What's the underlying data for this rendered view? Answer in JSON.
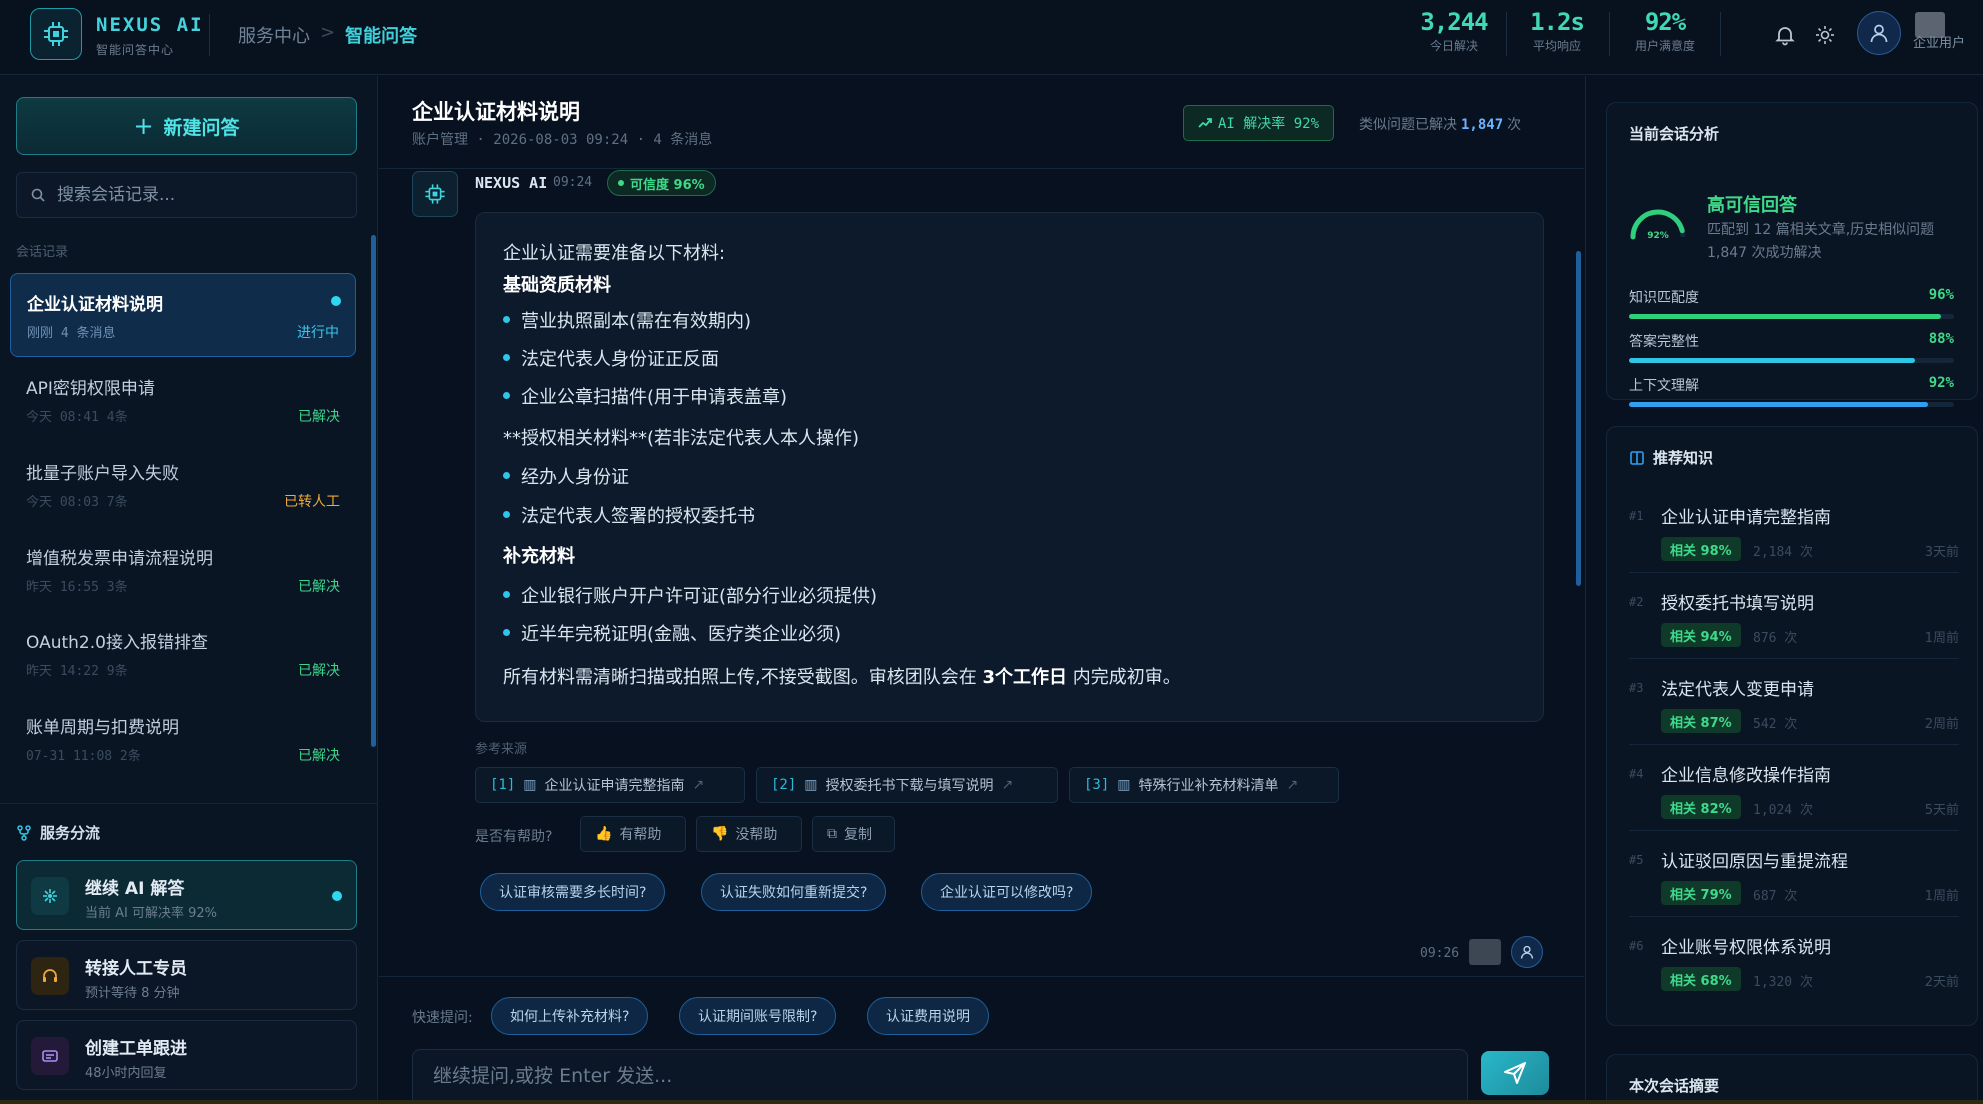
{
  "brand": {
    "name": "NEXUS AI",
    "subtitle": "智能问答中心"
  },
  "breadcrumb": {
    "parent": "服务中心",
    "separator": ">",
    "current": "智能问答"
  },
  "header_stats": [
    {
      "value": "3,244",
      "label": "今日解决"
    },
    {
      "value": "1.2s",
      "label": "平均响应"
    },
    {
      "value": "92%",
      "label": "用户满意度"
    }
  ],
  "user": {
    "label": "企业用户"
  },
  "sidebar": {
    "new_button": "新建问答",
    "search_placeholder": "搜索会话记录...",
    "section_label": "会话记录",
    "conversations": [
      {
        "title": "企业认证材料说明",
        "meta": "刚刚 4 条消息",
        "status": "进行中",
        "status_type": "ongoing",
        "active": true
      },
      {
        "title": "API密钥权限申请",
        "meta": "今天 08:41 4条",
        "status": "已解决",
        "status_type": "resolved"
      },
      {
        "title": "批量子账户导入失败",
        "meta": "今天 08:03 7条",
        "status": "已转人工",
        "status_type": "human"
      },
      {
        "title": "增值税发票申请流程说明",
        "meta": "昨天 16:55 3条",
        "status": "已解决",
        "status_type": "resolved"
      },
      {
        "title": "OAuth2.0接入报错排查",
        "meta": "昨天 14:22 9条",
        "status": "已解决",
        "status_type": "resolved"
      },
      {
        "title": "账单周期与扣费说明",
        "meta": "07-31 11:08 2条",
        "status": "已解决",
        "status_type": "resolved"
      }
    ],
    "routing": {
      "title": "服务分流",
      "items": [
        {
          "title": "继续 AI 解答",
          "sub": "当前 AI 可解决率 92%",
          "active": true
        },
        {
          "title": "转接人工专员",
          "sub": "预计等待 8 分钟"
        },
        {
          "title": "创建工单跟进",
          "sub": "48小时内回复"
        }
      ]
    }
  },
  "chat": {
    "title": "企业认证材料说明",
    "subtitle": "账户管理 · 2026-08-03 09:24 · 4 条消息",
    "ai_rate": "AI 解决率 92%",
    "similar_prefix": "类似问题已解决",
    "similar_count": "1,847",
    "similar_suffix": "次",
    "bot_name": "NEXUS AI",
    "bot_time": "09:24",
    "confidence": "可信度 96%",
    "message": {
      "intro": "企业认证需要准备以下材料:",
      "h1": "基础资质材料",
      "b1": "营业执照副本(需在有效期内)",
      "b2": "法定代表人身份证正反面",
      "b3": "企业公章扫描件(用于申请表盖章)",
      "p2": "**授权相关材料**(若非法定代表人本人操作)",
      "b4": "经办人身份证",
      "b5": "法定代表人签署的授权委托书",
      "h2": "补充材料",
      "b6": "企业银行账户开户许可证(部分行业必须提供)",
      "b7": "近半年完税证明(金融、医疗类企业必须)",
      "closing_pre": "所有材料需清晰扫描或拍照上传,不接受截图。审核团队会在",
      "closing_bold": "3个工作日",
      "closing_post": "内完成初审。"
    },
    "refs_label": "参考来源",
    "refs": [
      {
        "n": "[1]",
        "title": "企业认证申请完整指南"
      },
      {
        "n": "[2]",
        "title": "授权委托书下载与填写说明"
      },
      {
        "n": "[3]",
        "title": "特殊行业补充材料清单"
      }
    ],
    "feedback_label": "是否有帮助?",
    "feedback": {
      "helpful": "有帮助",
      "unhelpful": "没帮助",
      "copy": "复制"
    },
    "suggestions": [
      "认证审核需要多长时间?",
      "认证失败如何重新提交?",
      "企业认证可以修改吗?"
    ],
    "user_time": "09:26",
    "quick_label": "快速提问:",
    "quick": [
      "如何上传补充材料?",
      "认证期间账号限制?",
      "认证费用说明"
    ],
    "input_placeholder": "继续提问,或按 Enter 发送..."
  },
  "analysis": {
    "title": "当前会话分析",
    "gauge_label": "92%",
    "gauge_value": 0.92,
    "headline": "高可信回答",
    "desc": "匹配到 12 篇相关文章,历史相似问题 1,847 次成功解决",
    "metrics": [
      {
        "label": "知识匹配度",
        "value": "96%",
        "fraction": 0.96,
        "color": "#2fcf7d"
      },
      {
        "label": "答案完整性",
        "value": "88%",
        "fraction": 0.88,
        "color": "#2ec5e6"
      },
      {
        "label": "上下文理解",
        "value": "92%",
        "fraction": 0.92,
        "color": "#2f9ff0"
      }
    ]
  },
  "knowledge": {
    "title": "推荐知识",
    "items": [
      {
        "idx": "#1",
        "title": "企业认证申请完整指南",
        "rel": "相关 98%",
        "views": "2,184 次",
        "ago": "3天前"
      },
      {
        "idx": "#2",
        "title": "授权委托书填写说明",
        "rel": "相关 94%",
        "views": "876 次",
        "ago": "1周前"
      },
      {
        "idx": "#3",
        "title": "法定代表人变更申请",
        "rel": "相关 87%",
        "views": "542 次",
        "ago": "2周前"
      },
      {
        "idx": "#4",
        "title": "企业信息修改操作指南",
        "rel": "相关 82%",
        "views": "1,024 次",
        "ago": "5天前"
      },
      {
        "idx": "#5",
        "title": "认证驳回原因与重提流程",
        "rel": "相关 79%",
        "views": "687 次",
        "ago": "1周前"
      },
      {
        "idx": "#6",
        "title": "企业账号权限体系说明",
        "rel": "相关 68%",
        "views": "1,320 次",
        "ago": "2天前"
      }
    ]
  },
  "summary": {
    "title": "本次会话摘要"
  }
}
